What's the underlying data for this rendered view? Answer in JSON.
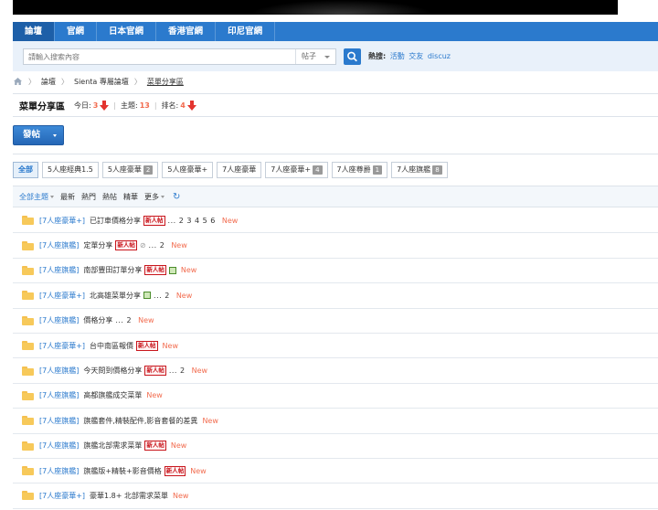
{
  "nav": {
    "items": [
      {
        "label": "論壇",
        "active": true
      },
      {
        "label": "官網",
        "active": false
      },
      {
        "label": "日本官網",
        "active": false
      },
      {
        "label": "香港官網",
        "active": false
      },
      {
        "label": "印尼官網",
        "active": false
      }
    ]
  },
  "search": {
    "placeholder": "請輸入搜索內容",
    "type_label": "帖子",
    "hot_label": "熱搜:",
    "hot_links": [
      "活動",
      "交友",
      "discuz"
    ]
  },
  "breadcrumb": {
    "items": [
      "論壇",
      "Sienta 專屬論壇",
      "菜單分享區"
    ]
  },
  "forum": {
    "name": "菜單分享區",
    "today_label": "今日:",
    "today_value": "3",
    "topics_label": "主題:",
    "topics_value": "13",
    "rank_label": "排名:",
    "rank_value": "4"
  },
  "post_button": {
    "label": "發帖"
  },
  "categories": [
    {
      "label": "全部",
      "count": "",
      "active": true
    },
    {
      "label": "5人座經典1.5",
      "count": ""
    },
    {
      "label": "5人座豪華",
      "count": "2"
    },
    {
      "label": "5人座豪華+",
      "count": ""
    },
    {
      "label": "7人座豪華",
      "count": ""
    },
    {
      "label": "7人座豪華+",
      "count": "4"
    },
    {
      "label": "7人座尊爵",
      "count": "1"
    },
    {
      "label": "7人座旗艦",
      "count": "8"
    }
  ],
  "filters": {
    "all_topics": "全部主題",
    "latest": "最新",
    "hot": "熱門",
    "hot_posts": "熱帖",
    "digest": "精華",
    "more": "更多"
  },
  "threads": [
    {
      "type": "[7人座豪華+]",
      "title": "已訂車價格分享",
      "newbie": "新人帖",
      "pages": "... 2  3  4  5  6",
      "new": "New",
      "attach": false,
      "clip": false
    },
    {
      "type": "[7人座旗艦]",
      "title": "定單分享",
      "newbie": "新人帖",
      "pages": "... 2",
      "new": "New",
      "attach": false,
      "clip": true
    },
    {
      "type": "[7人座旗艦]",
      "title": "南部豐田訂單分享",
      "newbie": "新人帖",
      "pages": "",
      "new": "New",
      "attach": true,
      "clip": false
    },
    {
      "type": "[7人座豪華+]",
      "title": "北高雄菜單分享",
      "newbie": "",
      "pages": "... 2",
      "new": "New",
      "attach": true,
      "clip": false
    },
    {
      "type": "[7人座旗艦]",
      "title": "價格分享",
      "newbie": "",
      "pages": "... 2",
      "new": "New",
      "attach": false,
      "clip": false
    },
    {
      "type": "[7人座豪華+]",
      "title": "台中南區報價",
      "newbie": "新人帖",
      "pages": "",
      "new": "New",
      "attach": false,
      "clip": false
    },
    {
      "type": "[7人座旗艦]",
      "title": "今天問到價格分享",
      "newbie": "新人帖",
      "pages": "... 2",
      "new": "New",
      "attach": false,
      "clip": false
    },
    {
      "type": "[7人座旗艦]",
      "title": "高都旗艦成交菜單",
      "newbie": "",
      "pages": "",
      "new": "New",
      "attach": false,
      "clip": false
    },
    {
      "type": "[7人座旗艦]",
      "title": "旗艦套件,精裝配件,影音套餐的差異",
      "newbie": "",
      "pages": "",
      "new": "New",
      "attach": false,
      "clip": false
    },
    {
      "type": "[7人座旗艦]",
      "title": "旗艦北部需求菜單",
      "newbie": "新人帖",
      "pages": "",
      "new": "New",
      "attach": false,
      "clip": false
    },
    {
      "type": "[7人座旗艦]",
      "title": "旗艦版+精裝+影音價格",
      "newbie": "新人帖",
      "pages": "",
      "new": "New",
      "attach": false,
      "clip": false
    },
    {
      "type": "[7人座豪華+]",
      "title": "豪華1.8+ 北部需求菜單",
      "newbie": "",
      "pages": "",
      "new": "New",
      "attach": false,
      "clip": false
    }
  ],
  "colors": {
    "primary": "#2b7acd",
    "nav_active": "#1d5fa8",
    "accent_red": "#f26c4f",
    "newbie_red": "#c8161d",
    "folder": "#f7c95a"
  }
}
